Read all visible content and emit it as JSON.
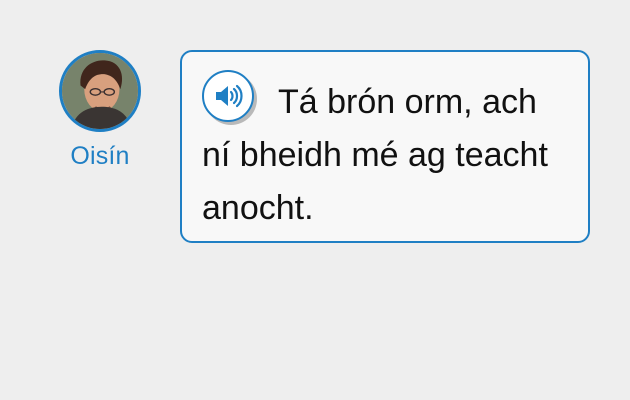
{
  "speaker": {
    "name": "Oisín",
    "avatar": "avatar-photo"
  },
  "bubble": {
    "audio_icon": "speaker-volume-icon",
    "text": "Tá brón orm, ach ní bheidh mé ag teacht anocht."
  },
  "colors": {
    "accent": "#1f7fc4",
    "background": "#eeeeee",
    "bubble_background": "#f8f8f8",
    "text": "#111111"
  }
}
